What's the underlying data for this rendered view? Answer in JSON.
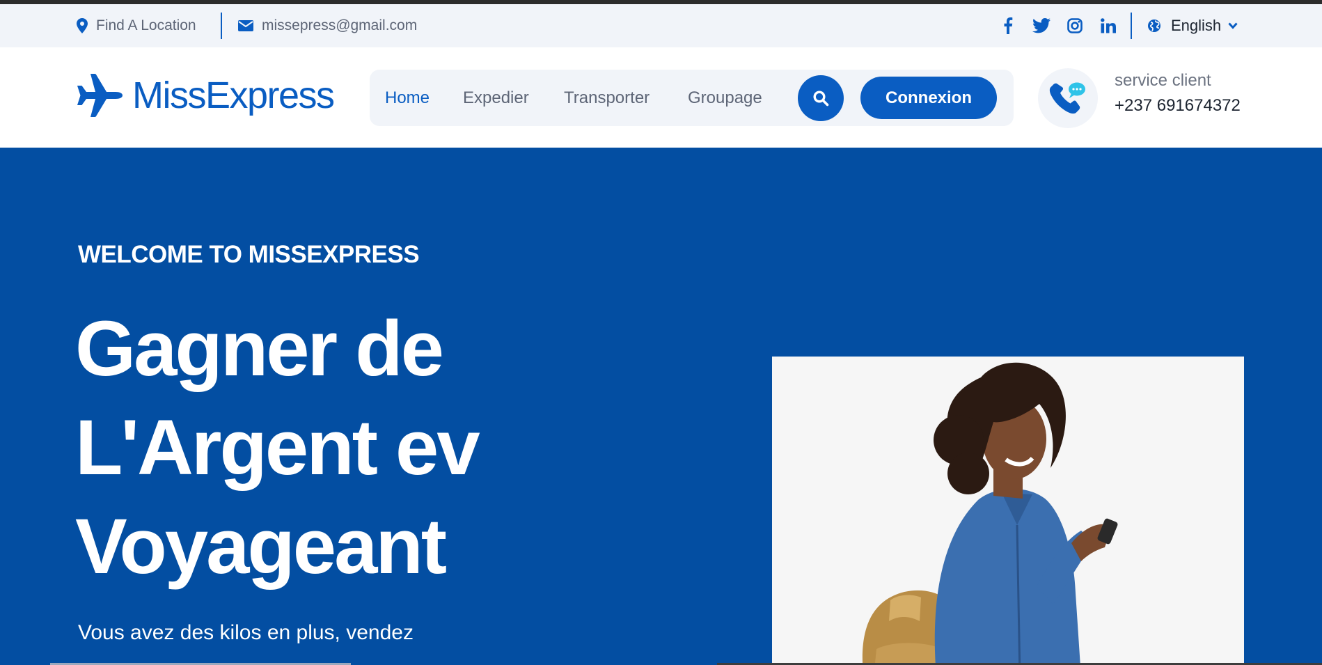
{
  "topbar": {
    "location_label": "Find A Location",
    "email": "missepress@gmail.com",
    "socials": [
      "facebook-icon",
      "twitter-icon",
      "instagram-icon",
      "linkedin-icon"
    ],
    "language": "English"
  },
  "header": {
    "logo_text": "MissExpress",
    "nav": [
      {
        "label": "Home",
        "active": true
      },
      {
        "label": "Expedier",
        "active": false
      },
      {
        "label": "Transporter",
        "active": false
      },
      {
        "label": "Groupage",
        "active": false
      }
    ],
    "connexion_label": "Connexion",
    "service_label": "service client",
    "service_phone": "+237 691674372"
  },
  "hero": {
    "eyebrow": "WELCOME TO MISSEXPRESS",
    "headline": [
      "Gagner de",
      "L'Argent ev",
      "Voyageant"
    ],
    "subtext": "Vous avez des kilos en plus, vendez"
  },
  "colors": {
    "brand": "#0a5dc2",
    "hero_bg": "#034ea2",
    "topbar_bg": "#f1f4f9"
  }
}
